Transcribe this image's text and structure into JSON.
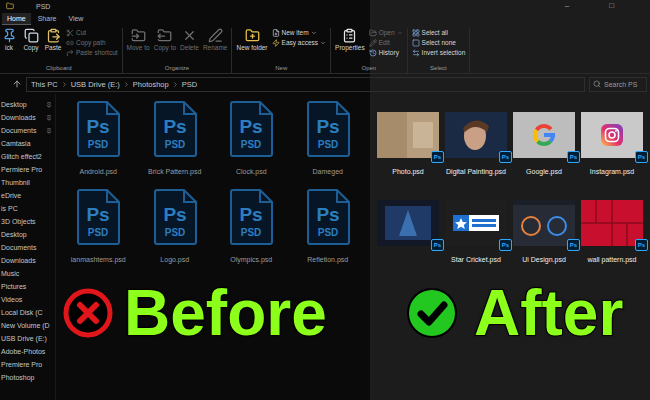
{
  "window": {
    "title": "PSD",
    "controls": [
      "–",
      "□"
    ]
  },
  "tabs": [
    {
      "label": "Home",
      "selected": true
    },
    {
      "label": "Share",
      "selected": false
    },
    {
      "label": "View",
      "selected": false
    }
  ],
  "ribbon": {
    "groups": [
      {
        "label": "Clipboard",
        "buttons": [
          {
            "label": "ick",
            "kind": "large",
            "disabled": false,
            "menu": false
          },
          {
            "label": "Copy",
            "kind": "large",
            "disabled": false,
            "menu": false
          },
          {
            "label": "Paste",
            "kind": "large",
            "disabled": false,
            "menu": false
          },
          {
            "label": "Cut",
            "kind": "small",
            "disabled": true,
            "menu": false
          },
          {
            "label": "Copy path",
            "kind": "small",
            "disabled": true,
            "menu": false
          },
          {
            "label": "Paste shortcut",
            "kind": "small",
            "disabled": true,
            "menu": false
          }
        ]
      },
      {
        "label": "Organize",
        "buttons": [
          {
            "label": "Move to",
            "kind": "large",
            "disabled": true,
            "menu": false
          },
          {
            "label": "Copy to",
            "kind": "large",
            "disabled": true,
            "menu": false
          },
          {
            "label": "Delete",
            "kind": "large",
            "disabled": true,
            "menu": false
          },
          {
            "label": "Rename",
            "kind": "large",
            "disabled": true,
            "menu": false
          }
        ]
      },
      {
        "label": "New",
        "buttons": [
          {
            "label": "New folder",
            "kind": "large",
            "disabled": false,
            "menu": false
          },
          {
            "label": "New item",
            "kind": "small",
            "disabled": false,
            "menu": true
          },
          {
            "label": "Easy access",
            "kind": "small",
            "disabled": false,
            "menu": true
          }
        ]
      },
      {
        "label": "Open",
        "buttons": [
          {
            "label": "Properties",
            "kind": "large",
            "disabled": false,
            "menu": false
          },
          {
            "label": "Open",
            "kind": "small",
            "disabled": true,
            "menu": true
          },
          {
            "label": "Edit",
            "kind": "small",
            "disabled": true,
            "menu": false
          },
          {
            "label": "History",
            "kind": "small",
            "disabled": false,
            "menu": false
          }
        ]
      },
      {
        "label": "Select",
        "buttons": [
          {
            "label": "Select all",
            "kind": "small",
            "disabled": false,
            "menu": false
          },
          {
            "label": "Select none",
            "kind": "small",
            "disabled": false,
            "menu": false
          },
          {
            "label": "Invert selection",
            "kind": "small",
            "disabled": false,
            "menu": false
          }
        ]
      }
    ]
  },
  "address": {
    "path": [
      "This PC",
      "USB Drive (E:)",
      "Photoshop",
      "PSD"
    ]
  },
  "search": {
    "placeholder": "Search PS"
  },
  "sidebar": {
    "items": [
      {
        "label": "Desktop",
        "pinned": true
      },
      {
        "label": "Downloads",
        "pinned": true
      },
      {
        "label": "Documents",
        "pinned": true
      },
      {
        "label": "Camtasia",
        "pinned": false
      },
      {
        "label": "Glitch effect2",
        "pinned": false
      },
      {
        "label": "Permiere Pro",
        "pinned": false
      },
      {
        "label": "Thumbnil",
        "pinned": false
      },
      {
        "label": "eDrive",
        "pinned": false
      },
      {
        "label": "is PC",
        "pinned": false
      },
      {
        "label": "3D Objects",
        "pinned": false
      },
      {
        "label": "Desktop",
        "pinned": false
      },
      {
        "label": "Documents",
        "pinned": false
      },
      {
        "label": "Downloads",
        "pinned": false
      },
      {
        "label": "Music",
        "pinned": false
      },
      {
        "label": "Pictures",
        "pinned": false
      },
      {
        "label": "Videos",
        "pinned": false
      },
      {
        "label": "Local Disk (C",
        "pinned": false
      },
      {
        "label": "New Volume (D",
        "pinned": false
      },
      {
        "label": "USB Drive (E:)",
        "pinned": false
      },
      {
        "label": "Adobe-Photos",
        "pinned": false
      },
      {
        "label": "Premiere Pro",
        "pinned": false
      },
      {
        "label": "Photoshop",
        "pinned": false
      }
    ]
  },
  "psd_icon": {
    "mark": "Ps",
    "type": "PSD"
  },
  "before": {
    "label": "Before",
    "files": [
      {
        "name": "Android.psd"
      },
      {
        "name": "Brick Pattern.psd"
      },
      {
        "name": "Clock.psd"
      },
      {
        "name": "Dameged"
      },
      {
        "name": "ianmashtems.psd"
      },
      {
        "name": "Logo.psd"
      },
      {
        "name": "Olympics.psd"
      },
      {
        "name": "Refletion.psd"
      }
    ]
  },
  "after": {
    "label": "After",
    "badge": "Ps",
    "files": [
      {
        "name": "Photo.psd",
        "kind": "photo"
      },
      {
        "name": "Digital Painting.psd",
        "kind": "painting"
      },
      {
        "name": "Google.psd",
        "kind": "google"
      },
      {
        "name": "Instagram.psd",
        "kind": "instagram"
      },
      {
        "kind": "avengers"
      },
      {
        "name": "Star Cricket.psd",
        "kind": "cricket"
      },
      {
        "name": "Ui Design.psd",
        "kind": "ui"
      },
      {
        "name": "wall pattern.psd",
        "kind": "pattern"
      }
    ]
  }
}
